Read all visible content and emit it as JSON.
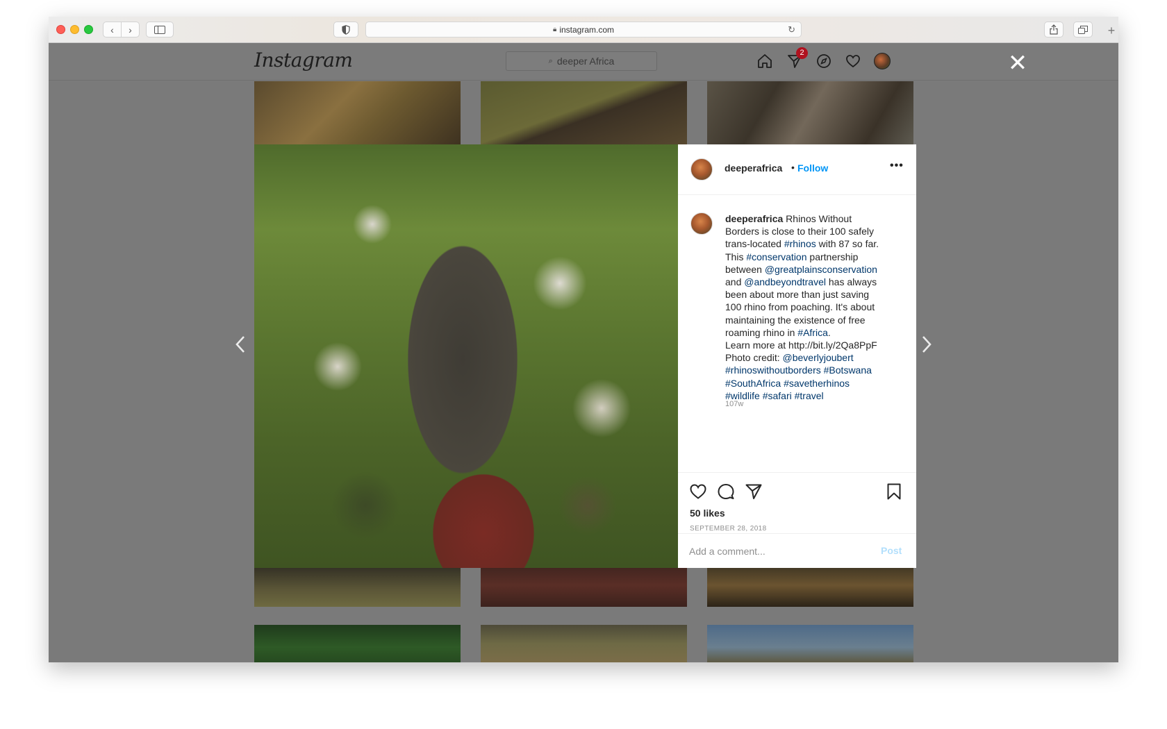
{
  "browser": {
    "url": "instagram.com"
  },
  "instagram": {
    "logo": "Instagram",
    "search_placeholder": "deeper Africa",
    "notifications_badge": "2"
  },
  "post": {
    "username": "deeperafrica",
    "dot": "•",
    "follow_label": "Follow",
    "more_label": "•••",
    "caption_lines": [
      [
        {
          "t": "deeperafrica",
          "k": "u"
        },
        {
          "t": " Rhinos Without",
          "k": "n"
        }
      ],
      [
        {
          "t": "Borders is close to their 100 safely",
          "k": "n"
        }
      ],
      [
        {
          "t": "trans-located ",
          "k": "n"
        },
        {
          "t": "#rhinos",
          "k": "tag"
        },
        {
          "t": " with 87 so far.",
          "k": "n"
        }
      ],
      [
        {
          "t": "This ",
          "k": "n"
        },
        {
          "t": "#conservation",
          "k": "tag"
        },
        {
          "t": " partnership",
          "k": "n"
        }
      ],
      [
        {
          "t": "between ",
          "k": "n"
        },
        {
          "t": "@greatplainsconservation",
          "k": "tag"
        }
      ],
      [
        {
          "t": "and ",
          "k": "n"
        },
        {
          "t": "@andbeyondtravel",
          "k": "tag"
        },
        {
          "t": " has always",
          "k": "n"
        }
      ],
      [
        {
          "t": "been about more than just saving",
          "k": "n"
        }
      ],
      [
        {
          "t": "100 rhino from poaching. It's about",
          "k": "n"
        }
      ],
      [
        {
          "t": "maintaining the existence of free",
          "k": "n"
        }
      ],
      [
        {
          "t": "roaming rhino in ",
          "k": "n"
        },
        {
          "t": "#Africa",
          "k": "tag"
        },
        {
          "t": ".",
          "k": "n"
        }
      ],
      [
        {
          "t": "Learn more at http://bit.ly/2Qa8PpF",
          "k": "n"
        }
      ],
      [
        {
          "t": "Photo credit: ",
          "k": "n"
        },
        {
          "t": "@beverlyjoubert",
          "k": "tag"
        }
      ],
      [
        {
          "t": "#rhinoswithoutborders",
          "k": "tag"
        },
        {
          "t": " ",
          "k": "n"
        },
        {
          "t": "#Botswana",
          "k": "tag"
        }
      ],
      [
        {
          "t": "#SouthAfrica",
          "k": "tag"
        },
        {
          "t": " ",
          "k": "n"
        },
        {
          "t": "#savetherhinos",
          "k": "tag"
        }
      ],
      [
        {
          "t": "#wildlife",
          "k": "tag"
        },
        {
          "t": " ",
          "k": "n"
        },
        {
          "t": "#safari",
          "k": "tag"
        },
        {
          "t": " ",
          "k": "n"
        },
        {
          "t": "#travel",
          "k": "tag"
        }
      ]
    ],
    "age": "107w",
    "likes": "50 likes",
    "date": "SEPTEMBER 28, 2018",
    "comment_placeholder": "Add a comment...",
    "post_label": "Post"
  },
  "colors": {
    "link": "#00376b",
    "follow": "#0095f6",
    "post_disabled": "#b2dffc",
    "overlay": "#7a7a7a"
  }
}
